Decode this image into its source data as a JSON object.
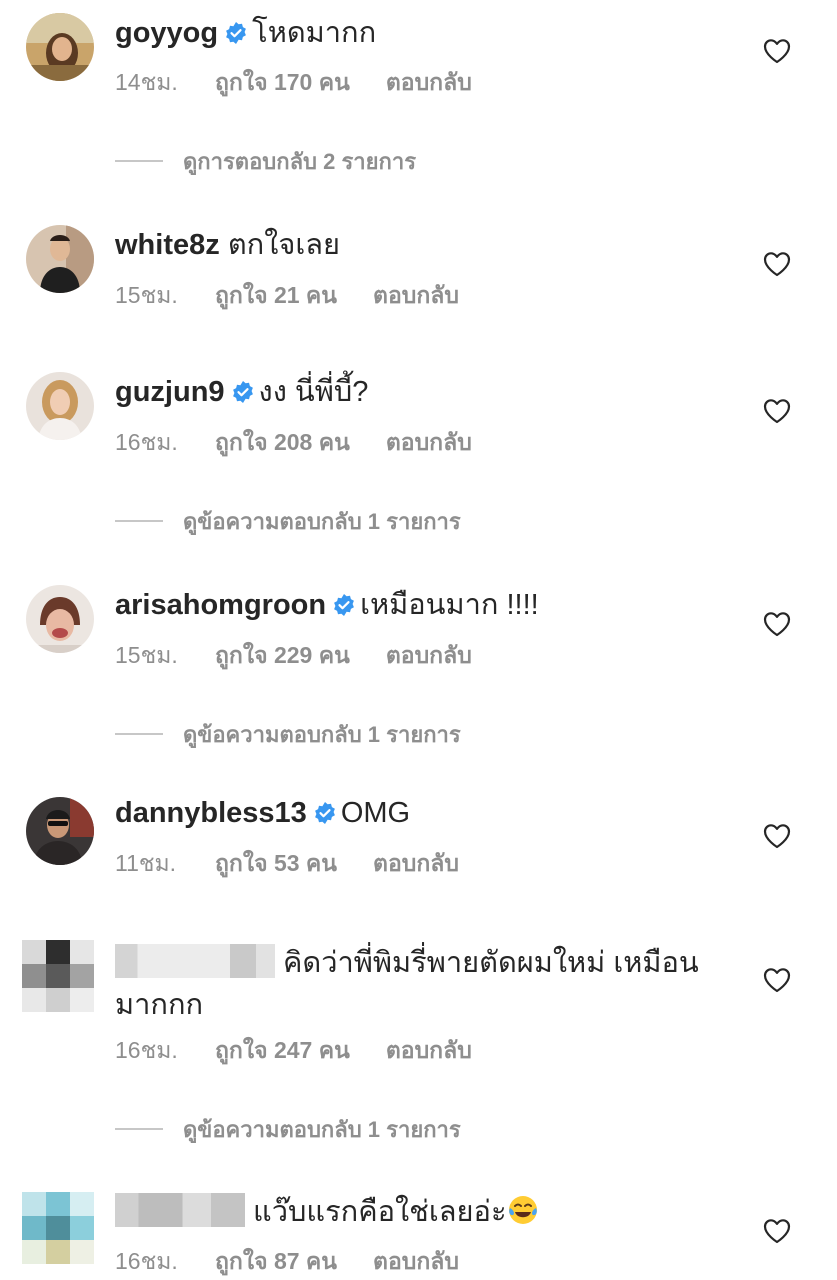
{
  "comments": [
    {
      "username": "goyyog",
      "verified": true,
      "text": "โหดมากก",
      "time": "14ชม.",
      "likes": "ถูกใจ 170 คน",
      "reply": "ตอบกลับ",
      "view_replies": "ดูการตอบกลับ 2 รายการ"
    },
    {
      "username": "white8z",
      "verified": false,
      "text": "ตกใจเลย",
      "time": "15ชม.",
      "likes": "ถูกใจ 21 คน",
      "reply": "ตอบกลับ"
    },
    {
      "username": "guzjun9",
      "verified": true,
      "text": "งง นี่พี่บี้?",
      "time": "16ชม.",
      "likes": "ถูกใจ 208 คน",
      "reply": "ตอบกลับ",
      "view_replies": "ดูข้อความตอบกลับ 1 รายการ"
    },
    {
      "username": "arisahomgroon",
      "verified": true,
      "text": "เหมือนมาก !!!!",
      "time": "15ชม.",
      "likes": "ถูกใจ 229 คน",
      "reply": "ตอบกลับ",
      "view_replies": "ดูข้อความตอบกลับ 1 รายการ"
    },
    {
      "username": "dannybless13",
      "verified": true,
      "text": "OMG",
      "time": "11ชม.",
      "likes": "ถูกใจ 53 คน",
      "reply": "ตอบกลับ"
    },
    {
      "username": "",
      "verified": false,
      "text": "คิดว่าพี่พิมรี่พายตัดผมใหม่ เหมือนมากกก",
      "time": "16ชม.",
      "likes": "ถูกใจ 247 คน",
      "reply": "ตอบกลับ",
      "view_replies": "ดูข้อความตอบกลับ 1 รายการ"
    },
    {
      "username": "",
      "verified": false,
      "text": "แว๊บแรกคือใช่เลยอ่ะ",
      "time": "16ชม.",
      "likes": "ถูกใจ 87 คน",
      "reply": "ตอบกลับ"
    }
  ],
  "colors": {
    "text": "#262626",
    "secondary": "#8e8e8e",
    "verified_blue": "#3897f0",
    "divider": "#c7c7c7"
  },
  "icons": {
    "like": "heart-outline-icon",
    "verified": "verified-badge-icon",
    "emoji": "face-with-tears-of-joy-emoji"
  }
}
